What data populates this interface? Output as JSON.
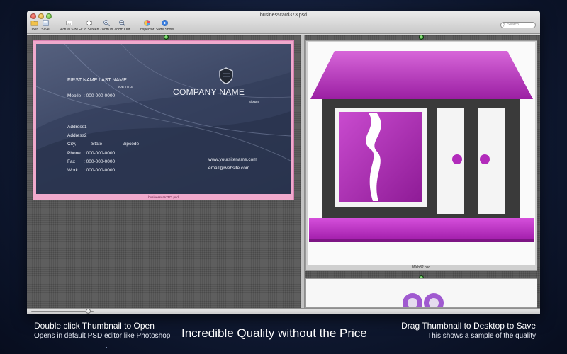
{
  "window": {
    "title": "businesscard373.psd"
  },
  "toolbar": {
    "open_label": "Open",
    "save_label": "Save",
    "actual_size_label": "Actual Size",
    "fit_to_screen_label": "Fit to Screen",
    "zoom_in_label": "Zoom In",
    "zoom_out_label": "Zoom Out",
    "inspector_label": "Inspector",
    "slide_show_label": "Slide Show",
    "search_placeholder": "Search"
  },
  "thumbnails": [
    {
      "filename": "businesscard373.psd",
      "card": {
        "name": "FIRST NAME LAST NAME",
        "job_title": "JOB TITLE",
        "mobile_label": "Mobile",
        "mobile": ": 000-000-0000",
        "company": "COMPANY NAME",
        "slogan": "Slogan",
        "address1": "Address1",
        "address2": "Address2",
        "city": "City,",
        "state": "State",
        "zipcode": "Zipcode",
        "phone_label": "Phone",
        "phone": ": 000-000-0000",
        "fax_label": "Fax",
        "fax": ": 000-000-0000",
        "work_label": "Work",
        "work": ": 000-000-0000",
        "website": "www.yoursitename.com",
        "email": "email@website.com"
      },
      "selected_color": "#f0a9cc"
    },
    {
      "filename": "Web32.psd",
      "accent": "#c23bc9"
    }
  ],
  "status": {
    "zoom_slider_value": 0.95
  },
  "captions": {
    "left_title": "Double click Thumbnail to Open",
    "left_sub": "Opens in default PSD editor like Photoshop",
    "center": "Incredible Quality without the Price",
    "right_title": "Drag Thumbnail to Desktop to Save",
    "right_sub": "This shows a sample of the quality"
  }
}
